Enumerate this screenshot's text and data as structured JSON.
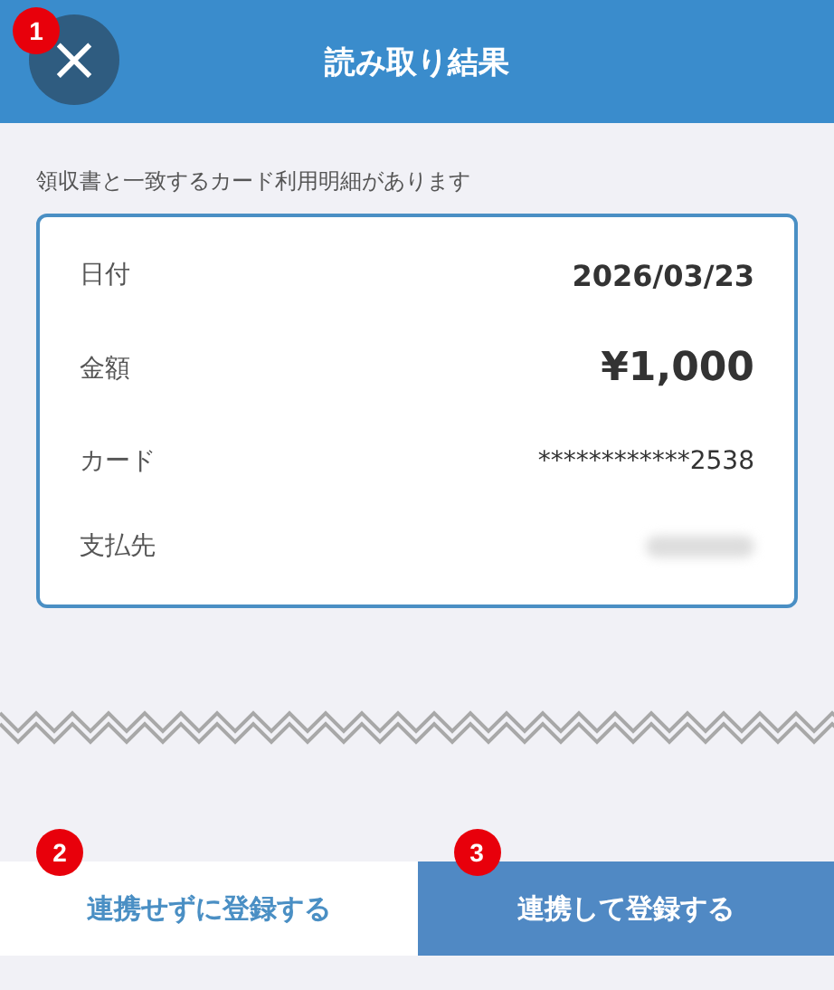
{
  "header": {
    "title": "読み取り結果",
    "close_icon": "×"
  },
  "message": "領収書と一致するカード利用明細があります",
  "details": [
    {
      "label": "日付",
      "value": "2026/03/23",
      "kind": "date"
    },
    {
      "label": "金額",
      "value": "¥1,000",
      "kind": "amount"
    },
    {
      "label": "カード",
      "value": "************2538",
      "kind": "card"
    },
    {
      "label": "支払先",
      "kind": "redacted"
    }
  ],
  "buttons": [
    {
      "label": "連携せずに登録する",
      "kind": "secondary"
    },
    {
      "label": "連携して登録する",
      "kind": "primary"
    }
  ],
  "markers": [
    "1",
    "2",
    "3"
  ]
}
